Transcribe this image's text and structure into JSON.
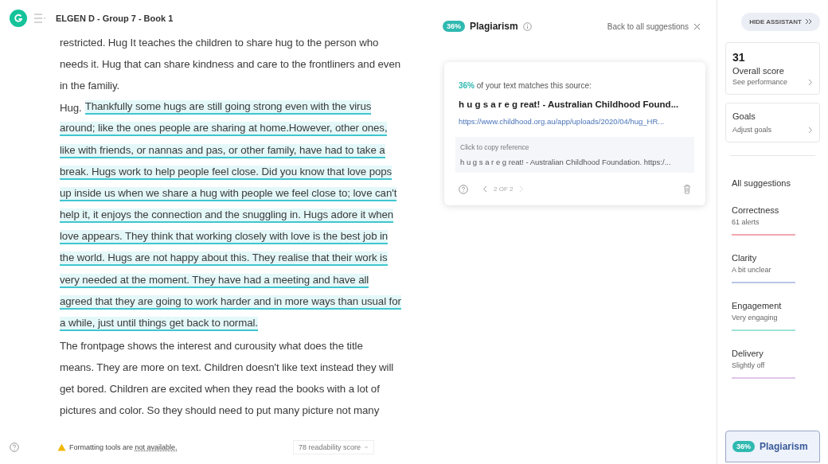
{
  "document": {
    "title": "ELGEN D - Group 7 - Book 1",
    "lines": [
      {
        "segments": [
          {
            "text": "restricted. Hug It teaches the children to share hug to the person who",
            "highlighted": false
          }
        ]
      },
      {
        "segments": [
          {
            "text": "needs it. Hug that can share kindness and care to the frontliners and even",
            "highlighted": false
          }
        ]
      },
      {
        "segments": [
          {
            "text": "in the familiy.",
            "highlighted": false
          }
        ]
      },
      {
        "segments": [
          {
            "text": "Hug.",
            "highlighted": false
          },
          {
            "text": "Thankfully some hugs are still going strong even with the virus",
            "highlighted": true
          }
        ]
      },
      {
        "segments": [
          {
            "text": "around; like the ones people are sharing at home.However, other ones,",
            "highlighted": true
          }
        ]
      },
      {
        "segments": [
          {
            "text": "like with friends, or nannas and pas, or other family, have had to take a",
            "highlighted": true
          }
        ]
      },
      {
        "segments": [
          {
            "text": "break. Hugs work to help people feel close. Did you know that love pops",
            "highlighted": true
          }
        ]
      },
      {
        "segments": [
          {
            "text": "up inside us when we share a hug with people we feel close to; love can't",
            "highlighted": true
          }
        ]
      },
      {
        "segments": [
          {
            "text": "help it, it enjoys the connection and the snuggling in. Hugs adore it when",
            "highlighted": true
          }
        ]
      },
      {
        "segments": [
          {
            "text": "love appears. They think that working closely with love is the best job in",
            "highlighted": true
          }
        ]
      },
      {
        "segments": [
          {
            "text": "the world. Hugs are not happy about this. They realise that their work is",
            "highlighted": true
          }
        ]
      },
      {
        "segments": [
          {
            "text": "very needed at the moment. They have had a meeting and have all",
            "highlighted": true
          }
        ]
      },
      {
        "segments": [
          {
            "text": "agreed that they are going to work harder and in more ways than usual for",
            "highlighted": true
          }
        ]
      },
      {
        "segments": [
          {
            "text": "a while, just until things get back to normal.",
            "highlighted": true
          }
        ]
      },
      {
        "segments": [
          {
            "text": "The frontpage shows the interest and curousity what does the title",
            "highlighted": false
          }
        ]
      },
      {
        "segments": [
          {
            "text": "means. They are more on text. Children doesn't like text instead they will",
            "highlighted": false
          }
        ]
      },
      {
        "segments": [
          {
            "text": "get bored. Children are excited when they read the books with a lot of",
            "highlighted": false
          }
        ]
      },
      {
        "segments": [
          {
            "text": "pictures and color. So they should need to put many picture not many",
            "highlighted": false
          }
        ]
      }
    ]
  },
  "status_bar": {
    "warning": "Formatting tools are",
    "warning_link": "not available.",
    "readability": "78 readability score"
  },
  "plagiarism_panel": {
    "badge": "36%",
    "title": "Plagiarism",
    "back_link": "Back to all suggestions",
    "card": {
      "match_percent": "36%",
      "match_text": "of your text matches this source:",
      "source_title": "h u g s a r e g reat! - Australian Childhood Found...",
      "source_url": "https://www.childhood.org.au/app/uploads/2020/04/hug_HR...",
      "copy_label": "Click to copy reference",
      "reference": "h u g s a r e g reat! - Australian Childhood Foundation. https:/...",
      "pager": "2 OF 2"
    }
  },
  "sidebar": {
    "hide_button": "HIDE ASSISTANT",
    "score": {
      "value": "31",
      "label": "Overall score",
      "link": "See performance"
    },
    "goals": {
      "label": "Goals",
      "link": "Adjust goals"
    },
    "all_suggestions": "All suggestions",
    "categories": [
      {
        "name": "Correctness",
        "status": "61 alerts",
        "color": "#f2a7b0"
      },
      {
        "name": "Clarity",
        "status": "A bit unclear",
        "color": "#b9c6e8"
      },
      {
        "name": "Engagement",
        "status": "Very engaging",
        "color": "#9fe3d6"
      },
      {
        "name": "Delivery",
        "status": "Slightly off",
        "color": "#e2c6ee"
      }
    ],
    "plagiarism": {
      "badge": "36%",
      "label": "Plagiarism",
      "selected": true
    }
  }
}
